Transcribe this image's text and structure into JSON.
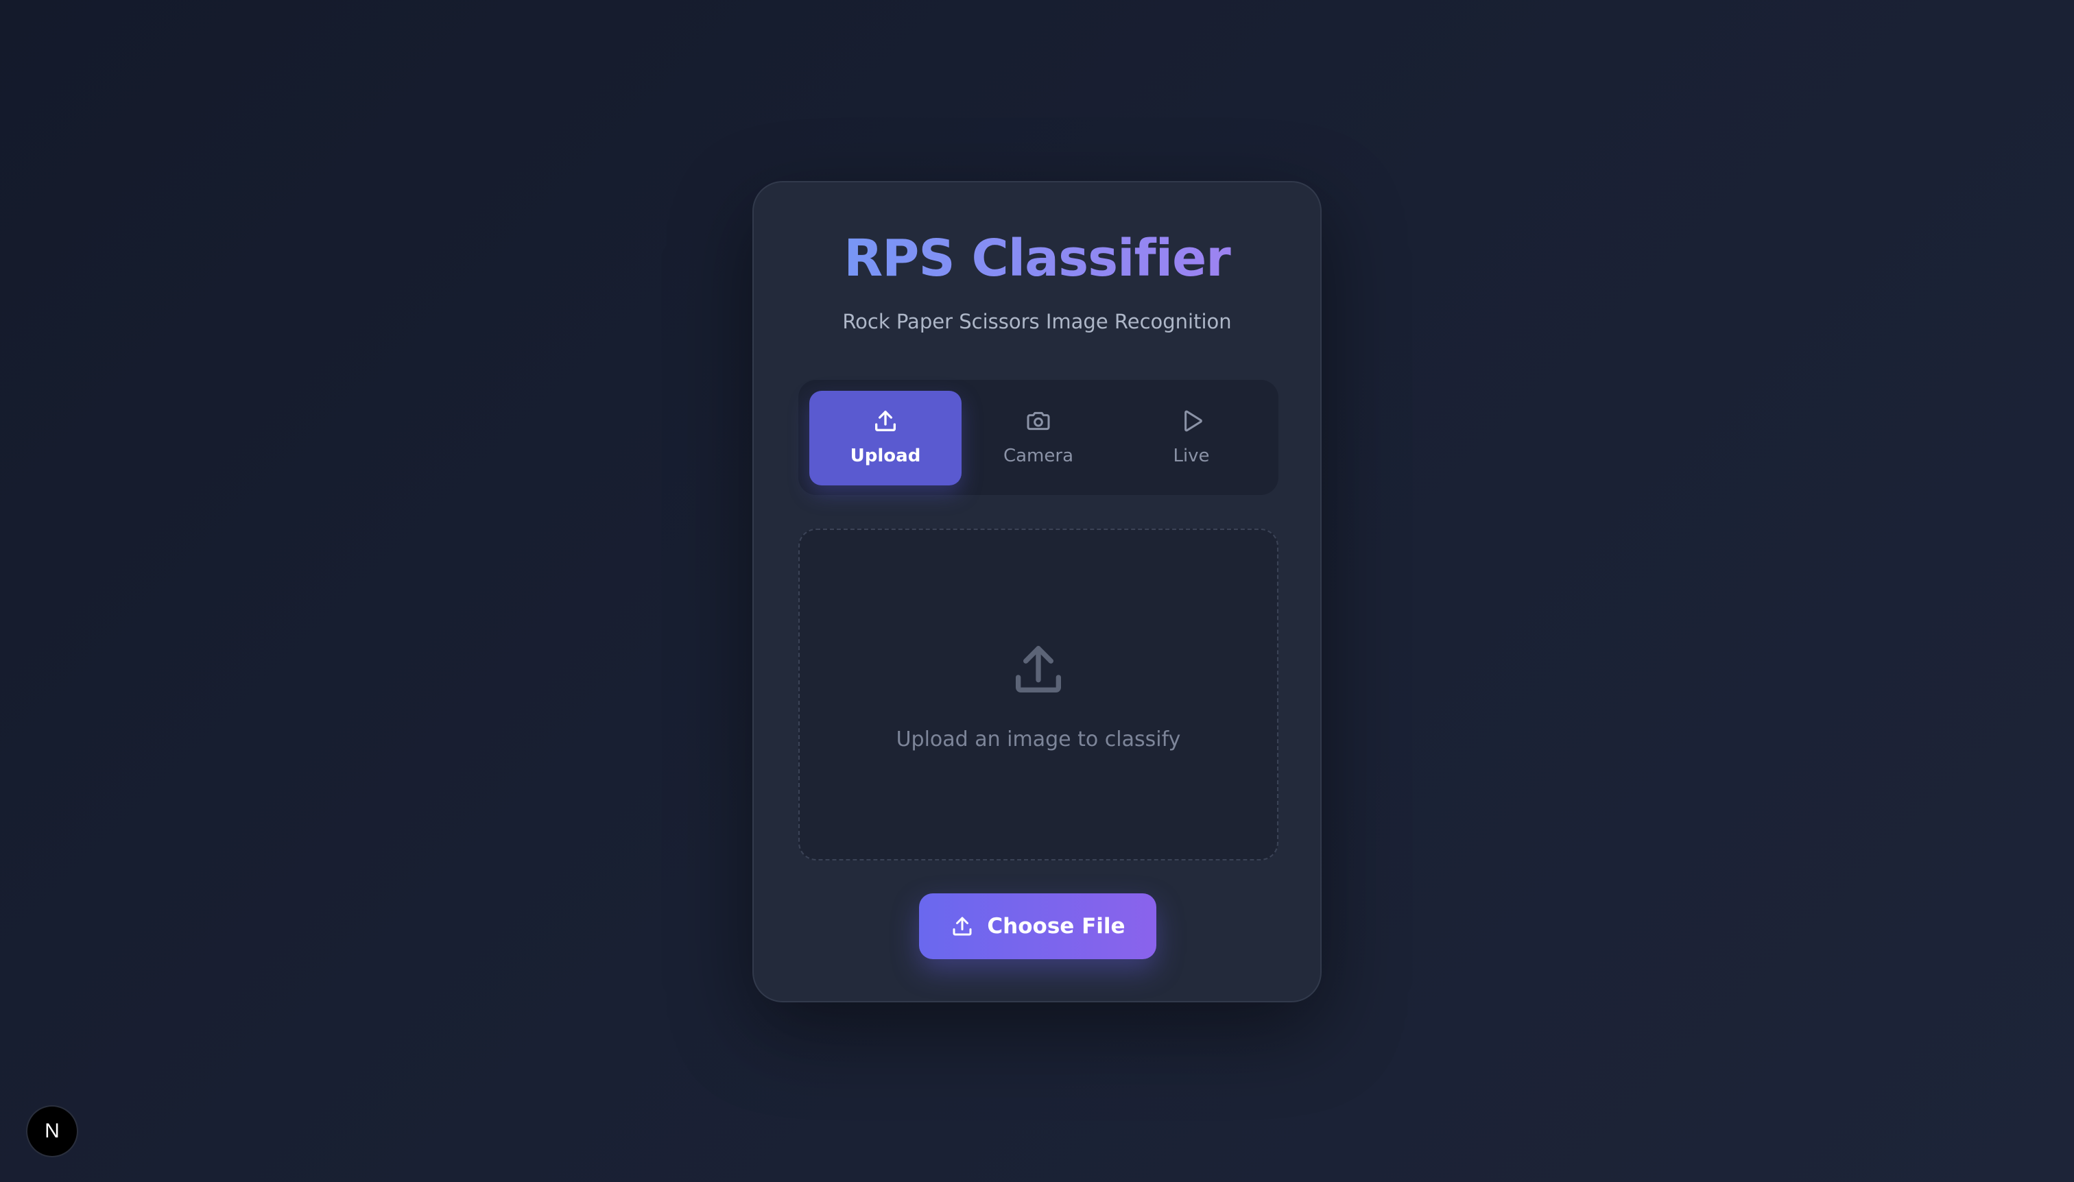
{
  "app": {
    "title": "RPS Classifier",
    "subtitle": "Rock Paper Scissors Image Recognition",
    "accent_color": "#5a5ad0",
    "gradient_colors": [
      "#6f9bf6",
      "#a57ff0"
    ]
  },
  "tabs": [
    {
      "label": "Upload",
      "icon": "upload-icon",
      "active": true
    },
    {
      "label": "Camera",
      "icon": "camera-icon",
      "active": false
    },
    {
      "label": "Live",
      "icon": "play-icon",
      "active": false
    }
  ],
  "dropzone": {
    "icon": "upload-icon",
    "text": "Upload an image to classify"
  },
  "choose_button": {
    "label": "Choose File",
    "icon": "upload-icon"
  },
  "badge": {
    "letter": "N",
    "icon": "next-logo-icon"
  }
}
